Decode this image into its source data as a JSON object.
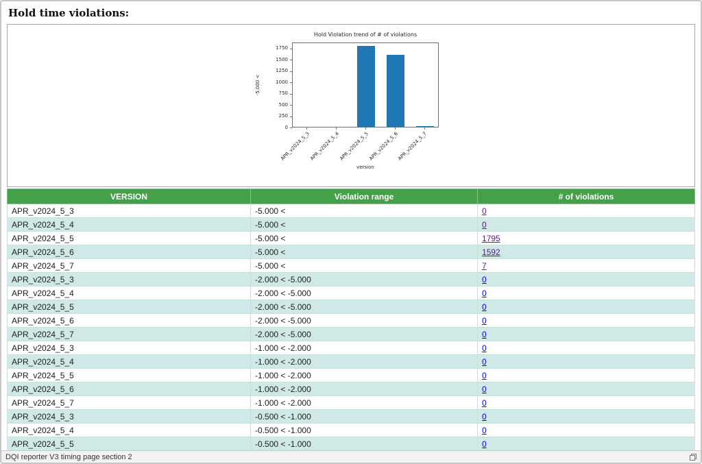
{
  "page": {
    "title": "Hold time violations:"
  },
  "footer": {
    "status": "DQI reporter V3 timing page section 2"
  },
  "colors": {
    "header_green": "#45a049",
    "stripe_teal": "#cfe9e6",
    "bar_blue": "#1f77b4",
    "link_blue": "#0000EE",
    "link_visited": "#551A8B"
  },
  "chart_data": {
    "type": "bar",
    "title": "Hold Violation trend of # of violations",
    "xlabel": "version",
    "ylabel": "-5.000 <",
    "categories": [
      "APR_v2024_5_3",
      "APR_v2024_5_4",
      "APR_v2024_5_5",
      "APR_v2024_5_6",
      "APR_v2024_5_7"
    ],
    "values": [
      0,
      0,
      1795,
      1592,
      7
    ],
    "ylim": [
      0,
      1880
    ],
    "yticks": [
      0,
      250,
      500,
      750,
      1000,
      1250,
      1500,
      1750
    ],
    "grid": false,
    "legend": "none",
    "bar_color": "#1f77b4"
  },
  "table": {
    "columns": [
      "VERSION",
      "Violation range",
      "# of violations"
    ],
    "rows": [
      {
        "version": "APR_v2024_5_3",
        "range": "-5.000 <",
        "count": "0",
        "visited": true
      },
      {
        "version": "APR_v2024_5_4",
        "range": "-5.000 <",
        "count": "0",
        "visited": true
      },
      {
        "version": "APR_v2024_5_5",
        "range": "-5.000 <",
        "count": "1795",
        "visited": true
      },
      {
        "version": "APR_v2024_5_6",
        "range": "-5.000 <",
        "count": "1592",
        "visited": true
      },
      {
        "version": "APR_v2024_5_7",
        "range": "-5.000 <",
        "count": "7",
        "visited": true
      },
      {
        "version": "APR_v2024_5_3",
        "range": "-2.000 < -5.000",
        "count": "0",
        "visited": false
      },
      {
        "version": "APR_v2024_5_4",
        "range": "-2.000 < -5.000",
        "count": "0",
        "visited": false
      },
      {
        "version": "APR_v2024_5_5",
        "range": "-2.000 < -5.000",
        "count": "0",
        "visited": false
      },
      {
        "version": "APR_v2024_5_6",
        "range": "-2.000 < -5.000",
        "count": "0",
        "visited": false
      },
      {
        "version": "APR_v2024_5_7",
        "range": "-2.000 < -5.000",
        "count": "0",
        "visited": false
      },
      {
        "version": "APR_v2024_5_3",
        "range": "-1.000 < -2.000",
        "count": "0",
        "visited": false
      },
      {
        "version": "APR_v2024_5_4",
        "range": "-1.000 < -2.000",
        "count": "0",
        "visited": false
      },
      {
        "version": "APR_v2024_5_5",
        "range": "-1.000 < -2.000",
        "count": "0",
        "visited": false
      },
      {
        "version": "APR_v2024_5_6",
        "range": "-1.000 < -2.000",
        "count": "0",
        "visited": false
      },
      {
        "version": "APR_v2024_5_7",
        "range": "-1.000 < -2.000",
        "count": "0",
        "visited": false
      },
      {
        "version": "APR_v2024_5_3",
        "range": "-0.500 < -1.000",
        "count": "0",
        "visited": false
      },
      {
        "version": "APR_v2024_5_4",
        "range": "-0.500 < -1.000",
        "count": "0",
        "visited": false
      },
      {
        "version": "APR_v2024_5_5",
        "range": "-0.500 < -1.000",
        "count": "0",
        "visited": false
      }
    ]
  }
}
